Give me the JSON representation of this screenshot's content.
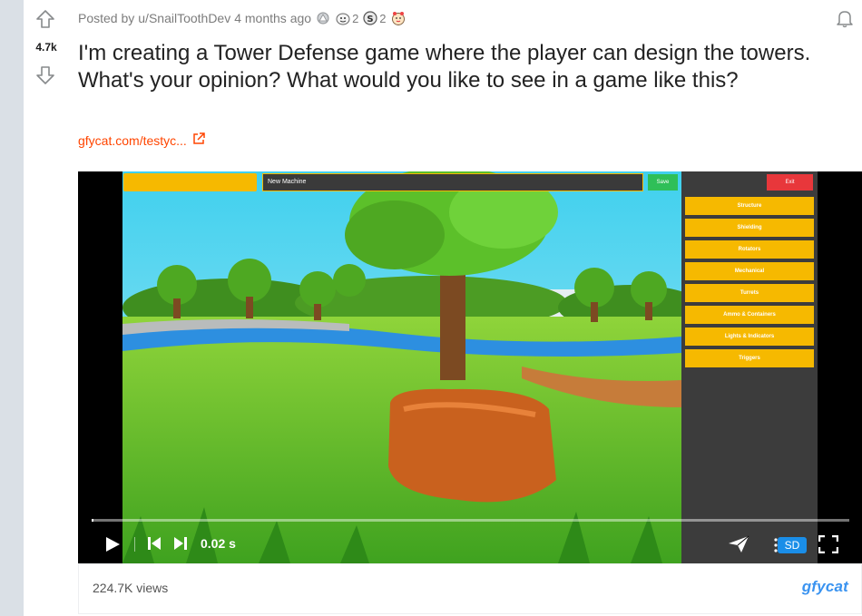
{
  "post": {
    "score": "4.7k",
    "posted_prefix": "Posted by",
    "author": "u/SnailToothDev",
    "age": "4 months ago",
    "awards": [
      {
        "icon": "silver-award-icon",
        "count": ""
      },
      {
        "icon": "helpful-award-icon",
        "count": "2"
      },
      {
        "icon": "s-coin-award-icon",
        "count": "2"
      },
      {
        "icon": "wholesome-award-icon",
        "count": ""
      }
    ],
    "title": "I'm creating a Tower Defense game where the player can design the towers. What's your opinion? What would you like to see in a game like this?",
    "link_text": "gfycat.com/testyc..."
  },
  "video": {
    "game_ui": {
      "name_field": "New Machine",
      "save_label": "Save",
      "exit_label": "Exit",
      "categories": [
        "Structure",
        "Shielding",
        "Rotators",
        "Mechanical",
        "Turrets",
        "Ammo & Containers",
        "Lights & Indicators",
        "Triggers"
      ]
    },
    "progress": 0.001,
    "time": "0.02 s",
    "quality": "SD"
  },
  "footer": {
    "views": "224.7K views",
    "brand": "gfycat"
  },
  "colors": {
    "accent": "#ff4500",
    "sd_badge": "#1a8ee8",
    "ui_yellow": "#f6b900"
  }
}
